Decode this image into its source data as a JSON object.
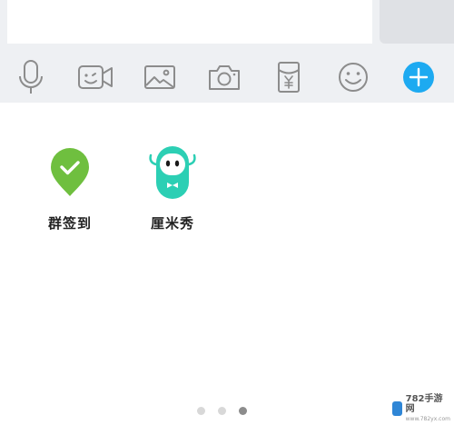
{
  "input": {
    "value": "",
    "placeholder": ""
  },
  "send_button": {
    "label": ""
  },
  "toolbar": {
    "items": [
      {
        "name": "voice",
        "icon": "microphone-icon"
      },
      {
        "name": "video",
        "icon": "video-camera-icon"
      },
      {
        "name": "image",
        "icon": "image-icon"
      },
      {
        "name": "camera",
        "icon": "camera-icon"
      },
      {
        "name": "red-packet",
        "icon": "red-packet-icon",
        "glyph": "¥"
      },
      {
        "name": "emoji",
        "icon": "smiley-icon"
      },
      {
        "name": "more",
        "icon": "plus-icon"
      }
    ]
  },
  "apps": [
    {
      "label": "群签到",
      "icon": "checkin-pin-icon",
      "color": "#6fbf3f"
    },
    {
      "label": "厘米秀",
      "icon": "cmshow-character-icon",
      "color": "#2ccfb4"
    }
  ],
  "pager": {
    "total": 3,
    "active": 3
  },
  "colors": {
    "accent": "#1daaf1",
    "toolbar_bg": "#eef0f3",
    "icon_stroke": "#8c8c8c"
  },
  "watermark": {
    "text": "782手游网",
    "sub": "www.782yx.com"
  }
}
